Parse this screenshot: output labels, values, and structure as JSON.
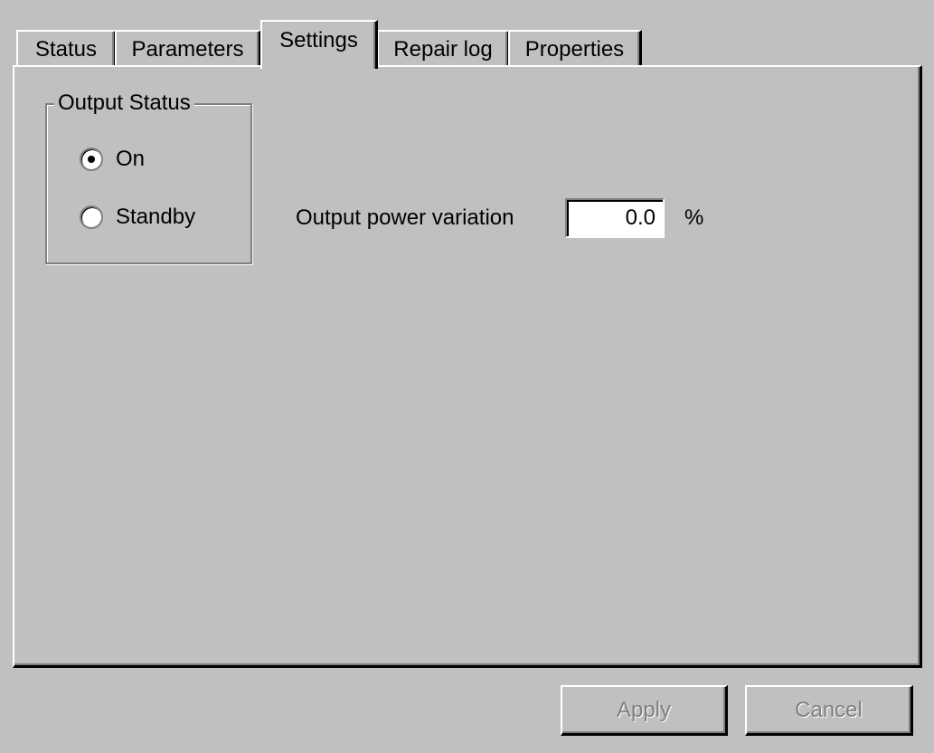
{
  "tabs": [
    "Status",
    "Parameters",
    "Settings",
    "Repair log",
    "Properties"
  ],
  "active_tab": "Settings",
  "output_status": {
    "title": "Output Status",
    "options": [
      "On",
      "Standby"
    ],
    "selected": "On"
  },
  "output_power_variation": {
    "label": "Output power variation",
    "value": "0.0",
    "unit": "%"
  },
  "buttons": {
    "apply": "Apply",
    "cancel": "Cancel"
  }
}
